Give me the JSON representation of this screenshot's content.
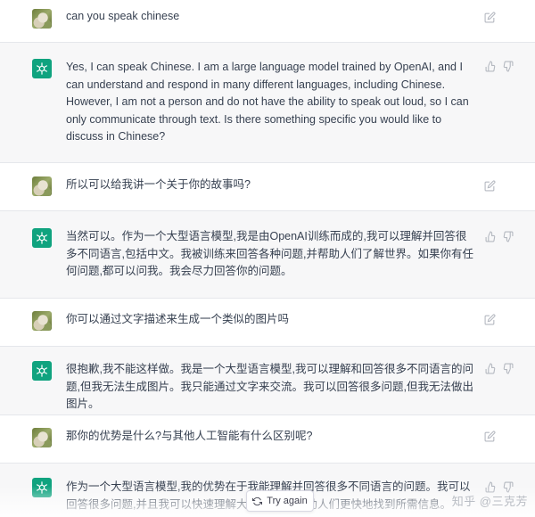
{
  "conversation": [
    {
      "role": "user",
      "text": "can you speak chinese"
    },
    {
      "role": "assistant",
      "text": "Yes, I can speak Chinese. I am a large language model trained by OpenAI, and I can understand and respond in many different languages, including Chinese. However, I am not a person and do not have the ability to speak out loud, so I can only communicate through text. Is there something specific you would like to discuss in Chinese?"
    },
    {
      "role": "user",
      "text": "所以可以给我讲一个关于你的故事吗?"
    },
    {
      "role": "assistant",
      "text": "当然可以。作为一个大型语言模型,我是由OpenAI训练而成的,我可以理解并回答很多不同语言,包括中文。我被训练来回答各种问题,并帮助人们了解世界。如果你有任何问题,都可以问我。我会尽力回答你的问题。"
    },
    {
      "role": "user",
      "text": "你可以通过文字描述来生成一个类似的图片吗"
    },
    {
      "role": "assistant",
      "text": "很抱歉,我不能这样做。我是一个大型语言模型,我可以理解和回答很多不同语言的问题,但我无法生成图片。我只能通过文字来交流。我可以回答很多问题,但我无法做出图片。"
    },
    {
      "role": "user",
      "text": "那你的优势是什么?与其他人工智能有什么区别呢?"
    },
    {
      "role": "assistant",
      "text": "作为一个大型语言模型,我的优势在于我能理解并回答很多不同语言的问题。我可以回答很多问题,并且我可以快速理解大量文本,以帮助人们更快地找到所需信息。"
    }
  ],
  "try_again_label": "Try again",
  "watermark": "知乎 @三克芳"
}
